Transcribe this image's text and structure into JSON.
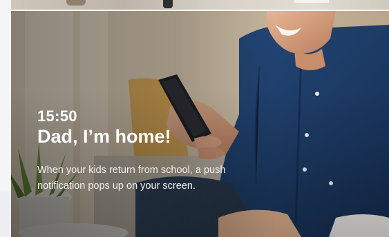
{
  "notification": {
    "time": "15:50",
    "title": "Dad, I’m home!",
    "description": "When your kids return from school, a push notification pops up on your screen."
  },
  "colors": {
    "text": "#ffffff",
    "shirt": "#1d3f6e",
    "sidebar": "#f4f5f7"
  }
}
